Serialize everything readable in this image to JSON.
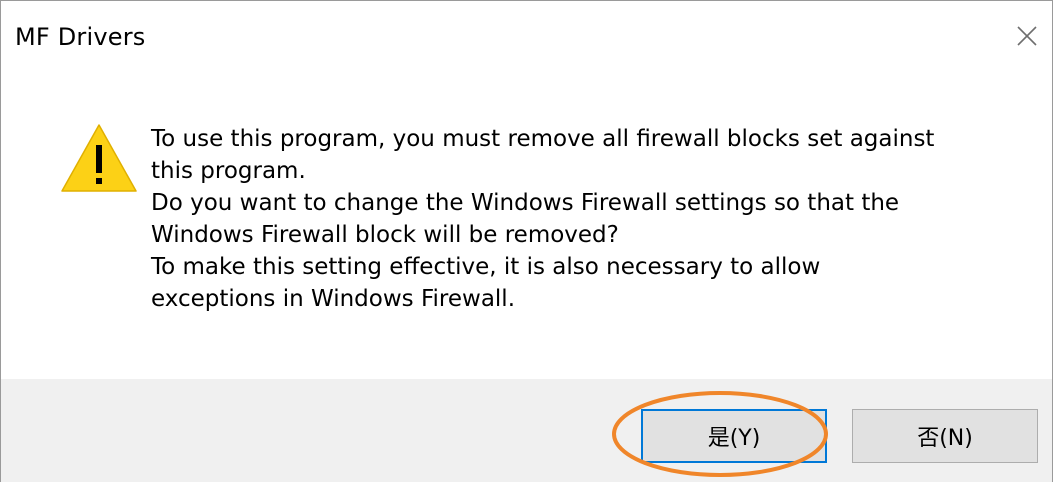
{
  "dialog": {
    "title": "MF Drivers",
    "message_lines": [
      "To use this program, you must remove all firewall blocks set against",
      "this program.",
      "Do you want to change the Windows Firewall settings so that the",
      "Windows Firewall block will be removed?",
      "To make this setting effective, it is also necessary to allow",
      "exceptions in Windows Firewall."
    ],
    "buttons": {
      "yes_label": "是(Y)",
      "no_label": "否(N)"
    }
  },
  "icons": {
    "warning": "warning-icon",
    "close": "close-icon"
  },
  "colors": {
    "warning_fill": "#fcd116",
    "highlight_ring": "#f0862a",
    "default_button_border": "#0078d7"
  }
}
